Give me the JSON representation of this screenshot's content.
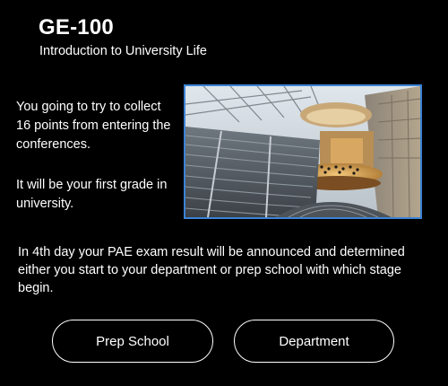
{
  "course": {
    "code": "GE-100",
    "name": "Introduction to University Life"
  },
  "body": {
    "paragraph_1": "You going to try to collect 16 points from entering the conferences.",
    "paragraph_2": "It will be your first grade in university.",
    "paragraph_3": "In 4th day your PAE exam result will be announced and determined either you start to your department or prep school with which stage begin."
  },
  "buttons": {
    "prep_school": "Prep School",
    "department": "Department"
  },
  "colors": {
    "background": "#000000",
    "text": "#ffffff",
    "image_border": "#3b82d6"
  }
}
